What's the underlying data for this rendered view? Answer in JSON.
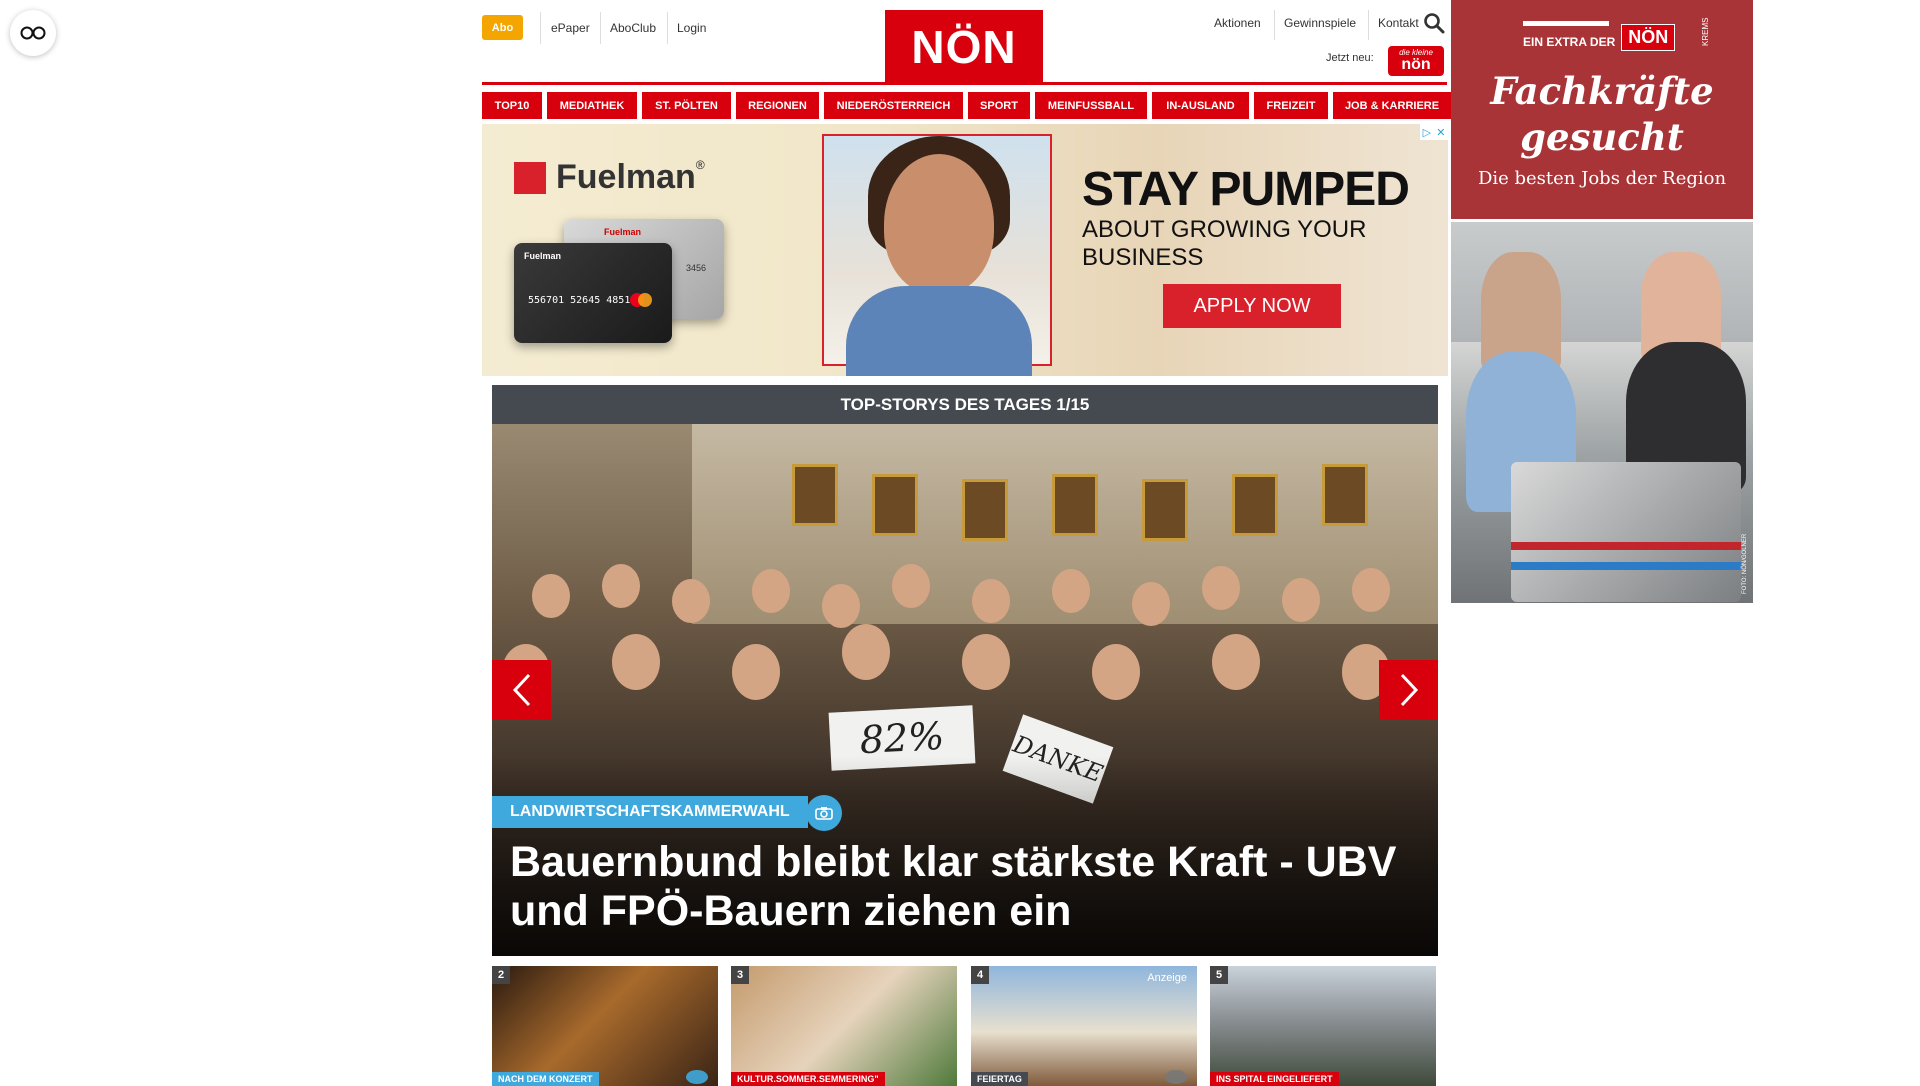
{
  "reader": {
    "icon": "reader-mode-icon"
  },
  "top_nav": {
    "abo": "Abo",
    "links": [
      "ePaper",
      "AboClub",
      "Login"
    ]
  },
  "logo": {
    "text": "NÖN"
  },
  "right_nav": {
    "links": [
      "Aktionen",
      "Gewinnspiele",
      "Kontakt"
    ],
    "jetzt_neu": "Jetzt neu:",
    "kleine_small": "die kleine",
    "kleine_big": "nön"
  },
  "categories": [
    "TOP10",
    "MEDIATHEK",
    "ST. PÖLTEN",
    "REGIONEN",
    "NIEDERÖSTERREICH",
    "SPORT",
    "MEINFUSSBALL",
    "IN-AUSLAND",
    "FREIZEIT",
    "JOB & KARRIERE"
  ],
  "ad_banner": {
    "brand": "Fuelman",
    "brand_reg": "®",
    "card_label": "Fuelman",
    "card_number": "556701 52645 485145",
    "card_small": "3456",
    "headline": "STAY PUMPED",
    "subline": "ABOUT GROWING YOUR BUSINESS",
    "cta": "APPLY NOW"
  },
  "slider": {
    "header": "TOP-STORYS DES TAGES 1/15",
    "sign1": "82%",
    "sign2": "DANKE",
    "category": "LANDWIRTSCHAFTSKAMMERWAHL",
    "headline": "Bauernbund bleibt klar stärkste Kraft - UBV und FPÖ-Bauern ziehen ein"
  },
  "thumbnails": [
    {
      "num": "2",
      "tag": "NACH DEM KONZERT",
      "tag_color": "#3fa9dd",
      "anzeige": ""
    },
    {
      "num": "3",
      "tag": "KULTUR.SOMMER.SEMMERING\"",
      "tag_color": "#d8000d",
      "anzeige": ""
    },
    {
      "num": "4",
      "tag": "FEIERTAG",
      "tag_color": "#444a4f",
      "anzeige": "Anzeige"
    },
    {
      "num": "5",
      "tag": "INS SPITAL EINGELIEFERT",
      "tag_color": "#d8000d",
      "anzeige": ""
    }
  ],
  "right_ad": {
    "extra": "EIN EXTRA DER",
    "noen": "NÖN",
    "region": "KREMS",
    "title_line1": "Fachkräfte",
    "title_line2": "gesucht",
    "subtitle": "Die besten Jobs der Region",
    "credit": "FOTO: NÖN/GOLNER"
  },
  "colors": {
    "brand_red": "#d8000d",
    "abo_orange": "#f5a500",
    "category_blue": "#3fa9dd",
    "right_ad_bg": "#a83437"
  }
}
